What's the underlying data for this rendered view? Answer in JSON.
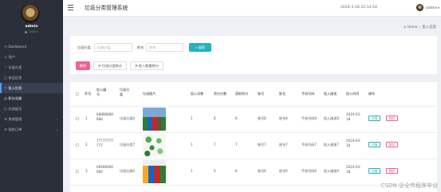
{
  "sidebar": {
    "user": {
      "name": "admin",
      "status": "Online"
    },
    "items": [
      {
        "icon": "dashboard-icon",
        "glyph": "◷",
        "label": "Dashboard"
      },
      {
        "icon": "user-icon",
        "glyph": "♙",
        "label": "用户"
      },
      {
        "icon": "category-icon",
        "glyph": "♡",
        "label": "垃圾分类"
      },
      {
        "icon": "product-icon",
        "glyph": "□",
        "label": "商品信息"
      },
      {
        "icon": "delivery-icon",
        "glyph": "♡",
        "label": "投入信息"
      },
      {
        "icon": "points-icon",
        "glyph": "◷",
        "label": "积分兑换"
      },
      {
        "icon": "forum-icon",
        "glyph": "□",
        "label": "在线留言"
      },
      {
        "icon": "system-icon",
        "glyph": "☰",
        "label": "系统管理"
      },
      {
        "icon": "orders-icon",
        "glyph": "☰",
        "label": "我的订单"
      }
    ]
  },
  "topbar": {
    "title": "垃圾分类管理系统",
    "datetime": "2024-3-18 22:14:54",
    "user": "admin"
  },
  "breadcrumb": {
    "home": "Home",
    "current": "投入信息"
  },
  "search": {
    "fields": [
      {
        "label": "垃圾分类",
        "placeholder": "垃圾分类"
      },
      {
        "label": "姓名",
        "placeholder": "姓名"
      }
    ],
    "search_label": "搜索",
    "stat_buttons": [
      "垃圾分类统计",
      "投入数量统计"
    ],
    "delete_label": "删除"
  },
  "table": {
    "headers": [
      "序号",
      "投入编号",
      "垃圾分类",
      "垃圾图片",
      "投入次数",
      "积分分数",
      "获取积分",
      "账号",
      "姓名",
      "手机号码",
      "投入描述",
      "投入时间",
      "操作"
    ],
    "rows": [
      {
        "index": "1",
        "code": "88888888888",
        "category": "垃圾分类8",
        "times": "1",
        "score": "8",
        "points": "8",
        "account": "账号8",
        "name": "姓名8",
        "phone": "手机号码8",
        "desc": "投入描述8",
        "time": "2024-03-18"
      },
      {
        "index": "2",
        "code": "77777777777",
        "category": "垃圾分类7",
        "times": "1",
        "score": "7",
        "points": "7",
        "account": "账号7",
        "name": "姓名7",
        "phone": "手机号码7",
        "desc": "投入描述7",
        "time": "2024-03-18"
      },
      {
        "index": "3",
        "code": "66666666666",
        "category": "垃圾分类6",
        "times": "1",
        "score": "6",
        "points": "6",
        "account": "账号6",
        "name": "姓名6",
        "phone": "手机号码6",
        "desc": "投入描述6",
        "time": "2024-03-18"
      }
    ],
    "detail_label": "详情",
    "delete_label": "删除"
  },
  "watermark": "CSDN @全传程序毕设"
}
